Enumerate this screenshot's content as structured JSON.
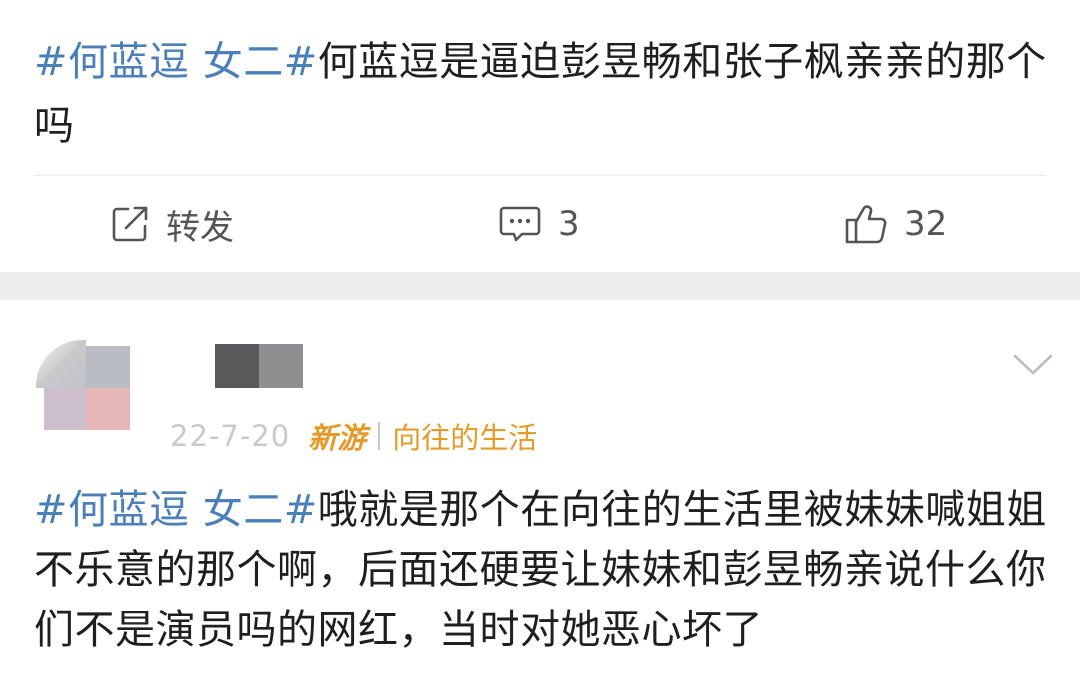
{
  "post": {
    "hashtag": "#何蓝逗 女二#",
    "text": "何蓝逗是逼迫彭昱畅和张子枫亲亲的那个吗"
  },
  "actions": {
    "repost_label": "转发",
    "comment_count": "3",
    "like_count": "32"
  },
  "comment": {
    "date": "22-7-20",
    "source": "新游",
    "topic": "向往的生活",
    "hashtag": "#何蓝逗 女二#",
    "text": "哦就是那个在向往的生活里被妹妹喊姐姐不乐意的那个啊，后面还硬要让妹妹和彭昱畅亲说什么你们不是演员吗的网红，当时对她恶心坏了"
  },
  "icons": {
    "repost": "edit-share-icon",
    "comment": "comment-icon",
    "like": "thumbs-up-icon",
    "more": "chevron-down-icon"
  },
  "colors": {
    "hashtag": "#4a7fb8",
    "source": "#e59b29",
    "separator_band": "#eeeeee"
  }
}
